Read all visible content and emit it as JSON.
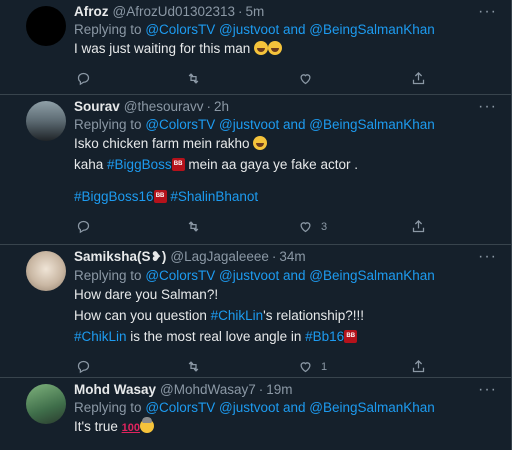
{
  "tweets": [
    {
      "name": "Afroz",
      "handle": "@AfrozUd01302313",
      "time": "5m",
      "replying_prefix": "Replying to",
      "mentions": "@ColorsTV @justvoot and @BeingSalmanKhan",
      "lines": [
        {
          "text": "I was just waiting for this man",
          "emoji": "face-with-tears-of-joy x2"
        }
      ],
      "like_count": "",
      "avatar_color": "#000000"
    },
    {
      "name": "Sourav",
      "handle": "@thesouravv",
      "time": "2h",
      "replying_prefix": "Replying to",
      "mentions": "@ColorsTV @justvoot and @BeingSalmanKhan",
      "line1": "Isko chicken farm mein rakho",
      "line2_pre": "kaha",
      "line2_hash": "#BiggBoss",
      "line2_post": "mein aa gaya ye fake actor .",
      "hashtags": [
        "#BiggBoss16",
        "#ShalinBhanot"
      ],
      "like_count": "3",
      "avatar_color": "#6e7681"
    },
    {
      "name": "Samiksha(S❥)",
      "handle": "@LagJagaleeee",
      "time": "34m",
      "replying_prefix": "Replying to",
      "mentions": "@ColorsTV @justvoot and @BeingSalmanKhan",
      "line1": "How dare you Salman?!",
      "line2_pre": "How can you question",
      "line2_hash": "#ChikLin",
      "line2_post": "'s relationship?!!!",
      "line3_hash": "#ChikLin",
      "line3_mid": "is the most real love angle in",
      "line3_hash2": "#Bb16",
      "like_count": "1",
      "avatar_color": "#c8b8a6"
    },
    {
      "name": "Mohd Wasay",
      "handle": "@MohdWasay7",
      "time": "19m",
      "replying_prefix": "Replying to",
      "mentions": "@ColorsTV @justvoot and @BeingSalmanKhan",
      "line1": "It's true",
      "avatar_color": "#4e8a5b"
    }
  ],
  "colors": {
    "background": "#15202b",
    "link": "#1d9bf0",
    "muted": "#8b98a5",
    "divider": "#38444d"
  },
  "icons": [
    "reply-icon",
    "retweet-icon",
    "like-icon",
    "share-icon",
    "more-icon"
  ]
}
